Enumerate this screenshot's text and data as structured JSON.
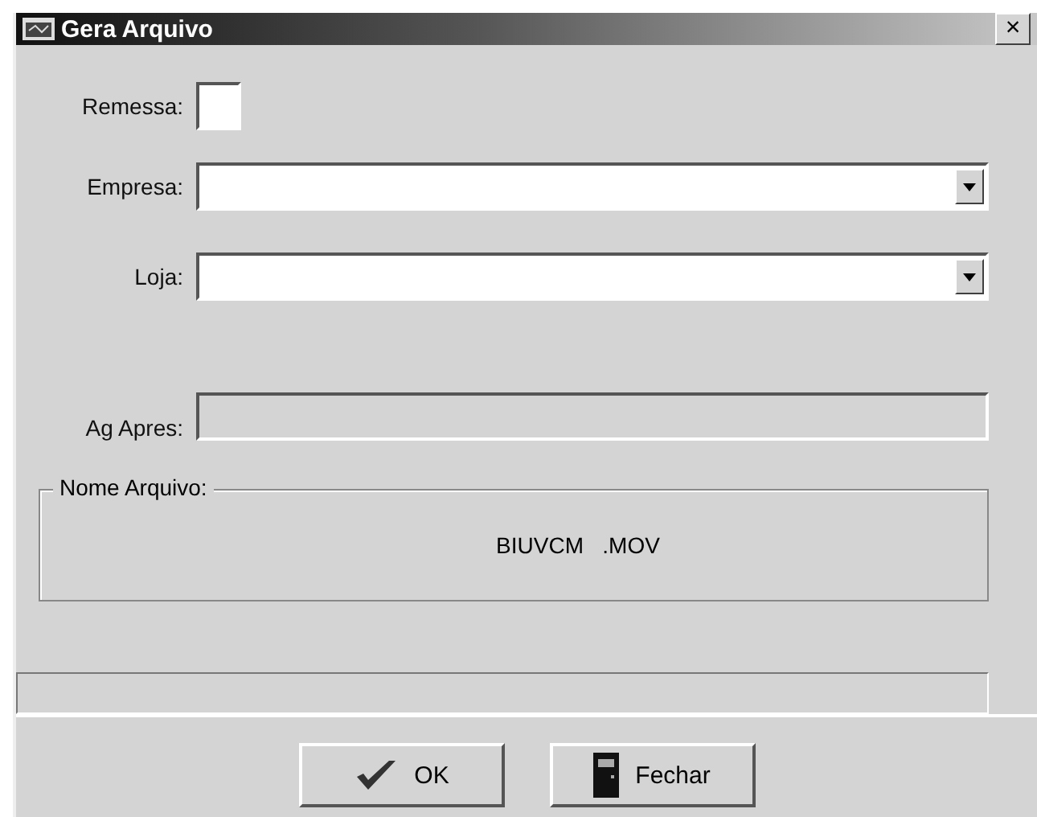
{
  "window": {
    "title": "Gera Arquivo",
    "close": "×"
  },
  "fields": [
    {
      "label": "Remessa:",
      "kind": "small",
      "disabled": false
    },
    {
      "label": "Empresa:",
      "kind": "combo",
      "disabled": false
    },
    {
      "label": "Loja:",
      "kind": "combo",
      "disabled": false
    },
    {
      "label": "Ag Apres:",
      "kind": "input",
      "disabled": true
    }
  ],
  "file_group": {
    "legend": "Nome Arquivo:",
    "value": "BIUVCM   .MOV"
  },
  "buttons": [
    {
      "label": "OK",
      "kind": "ok"
    },
    {
      "label": "Fechar",
      "kind": "close"
    }
  ]
}
